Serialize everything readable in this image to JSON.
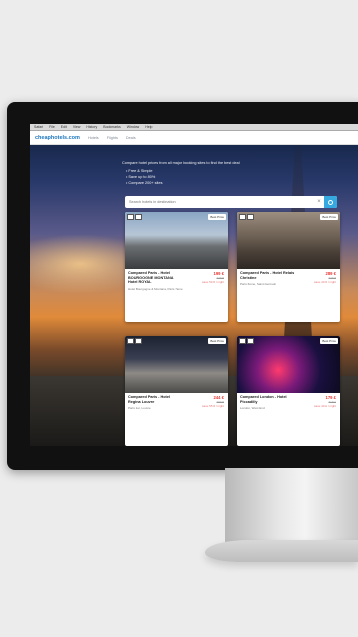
{
  "app": {
    "menu": [
      "Safari",
      "File",
      "Edit",
      "View",
      "History",
      "Bookmarks",
      "Window",
      "Help"
    ],
    "logo": "cheaphotels.com",
    "nav_links": [
      "Hotels",
      "Flights",
      "Deals"
    ]
  },
  "intro": {
    "headline": "Compare hotel prices from all major booking sites to find the best deal",
    "bullets": [
      "Free & Simple",
      "Save up to 80%",
      "Compare 200+ sites"
    ]
  },
  "search": {
    "placeholder": "Search hotels in destination"
  },
  "cards": [
    {
      "name": "Compared Paris - Hotel BOURGOGNE MONTANA Hotel ROYAL",
      "meta": "Hotel Bourgogne & Montana, Paris 7ème",
      "price_new": "199 €",
      "price_old": "249 €",
      "save": "save 50 € / night",
      "tag": "Best Price"
    },
    {
      "name": "Compared Paris - Hotel Relais Christine",
      "meta": "Paris 6ème, Saint-Germain",
      "price_new": "289 €",
      "price_old": "329 €",
      "save": "save 40 € / night",
      "tag": "Best Price"
    },
    {
      "name": "Compared Paris - Hotel Regina Louvre",
      "meta": "Paris 1er, Louvre",
      "price_new": "244 €",
      "price_old": "299 €",
      "save": "save 55 € / night",
      "tag": "Best Price"
    },
    {
      "name": "Compared London - Hotel Piccadilly",
      "meta": "London, West End",
      "price_new": "179 £",
      "price_old": "219 £",
      "save": "save 40 £ / night",
      "tag": "Best Price"
    }
  ],
  "colors": {
    "accent": "#35a9e0",
    "brand": "#1d77bd",
    "price": "#e53935"
  }
}
